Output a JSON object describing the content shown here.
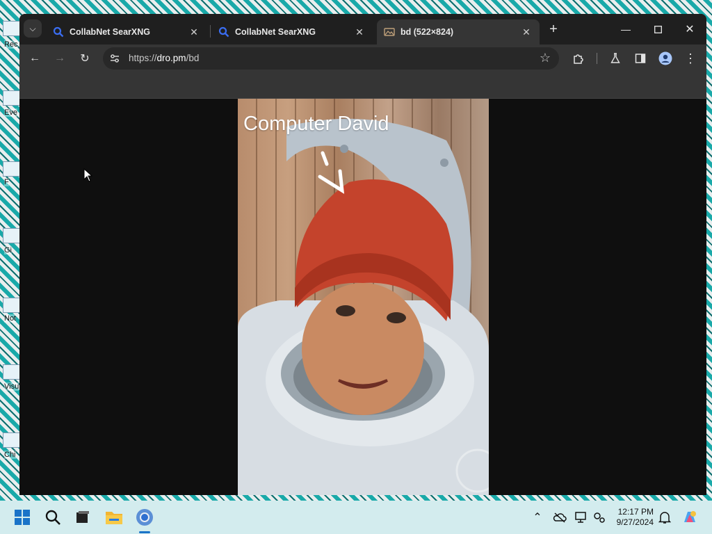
{
  "desktop": {
    "icon_labels": [
      "Rec",
      "Eve",
      "F",
      "Gi",
      "Not",
      "Visu",
      "Chi"
    ]
  },
  "browser": {
    "tabs": [
      {
        "title": "CollabNet SearXNG",
        "icon": "search-icon",
        "active": false
      },
      {
        "title": "CollabNet SearXNG",
        "icon": "search-icon",
        "active": false
      },
      {
        "title": "bd (522×824)",
        "icon": "image-icon",
        "active": true
      }
    ],
    "url_scheme": "https://",
    "url_host": "dro.pm",
    "url_path": "/bd",
    "colors": {
      "frame": "#1f1f1f",
      "toolbar": "#353535",
      "content_bg": "#0f0f0f"
    }
  },
  "image": {
    "caption": "Computer David",
    "alt": "bd (522×824)"
  },
  "taskbar": {
    "time": "12:17 PM",
    "date": "9/27/2024",
    "pinned": [
      "windows-start-icon",
      "search-icon",
      "task-view-icon",
      "file-explorer-icon",
      "chrome-icon"
    ],
    "tray": [
      "chevron-up-icon",
      "onedrive-icon",
      "display-icon",
      "network-icon",
      "bell-icon",
      "copilot-icon"
    ],
    "colors": {
      "background": "#d3ecee"
    }
  }
}
